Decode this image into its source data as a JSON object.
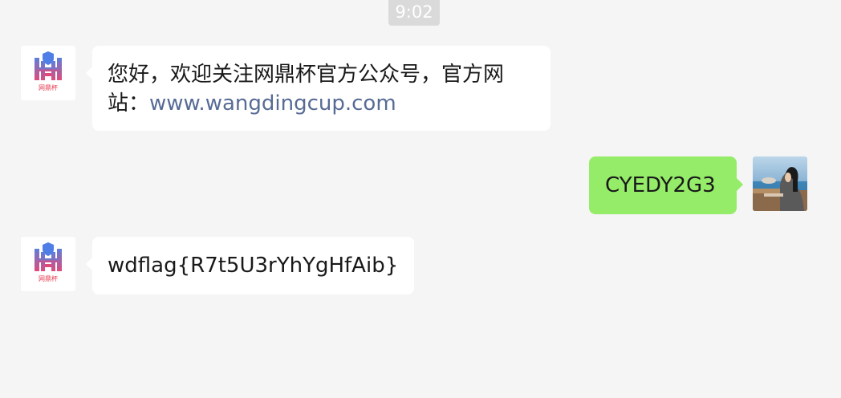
{
  "timestamp": "9:02",
  "contact": {
    "avatar_logo_text": "网鼎杯",
    "brand_colors": {
      "shield": "#4e7ee6",
      "frame_gradient_top": "#5b7fdc",
      "frame_gradient_bottom": "#e04a7a",
      "text": "#e6394f"
    }
  },
  "messages": [
    {
      "side": "left",
      "text_before_link": "您好，欢迎关注网鼎杯官方公众号，官方网站：",
      "link_text": "www.wangdingcup.com"
    },
    {
      "side": "right",
      "text": "CYEDY2G3"
    },
    {
      "side": "left",
      "text": "wdflag{R7t5U3rYhYgHfAib}"
    }
  ],
  "colors": {
    "background": "#f5f5f5",
    "left_bubble": "#ffffff",
    "right_bubble": "#95ec69",
    "link": "#576b95",
    "time_badge": "#dadada"
  }
}
